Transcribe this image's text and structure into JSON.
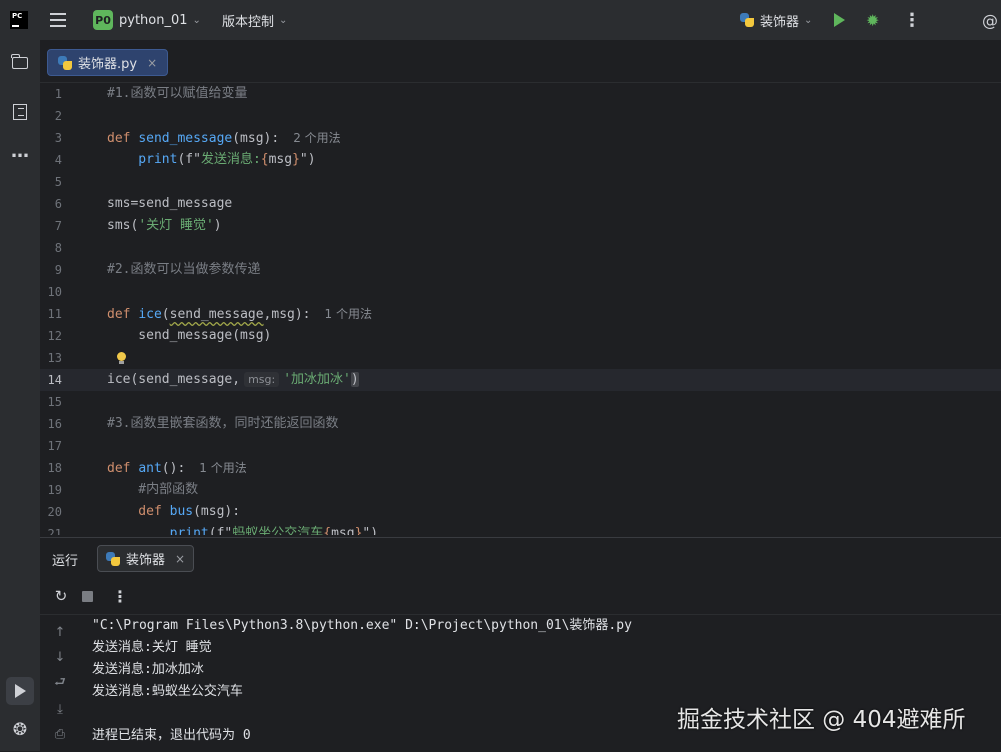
{
  "titlebar": {
    "logo_text": "PC",
    "project_badge": "P0",
    "project_name": "python_01",
    "vcs_label": "版本控制",
    "run_config": "装饰器"
  },
  "editor_tab": {
    "file_name": "装饰器.py"
  },
  "code_lines": [
    {
      "n": "1",
      "tokens": [
        {
          "t": "#1.函数可以赋值给变量",
          "c": "cmt"
        }
      ]
    },
    {
      "n": "2",
      "tokens": []
    },
    {
      "n": "3",
      "tokens": [
        {
          "t": "def ",
          "c": "kw"
        },
        {
          "t": "send_message",
          "c": "fn"
        },
        {
          "t": "(msg):",
          "c": ""
        }
      ],
      "hint": "2 个用法"
    },
    {
      "n": "4",
      "tokens": [
        {
          "t": "    print",
          "c": "fn"
        },
        {
          "t": "(f\"",
          "c": ""
        },
        {
          "t": "发送消息:",
          "c": "str"
        },
        {
          "t": "{",
          "c": "fstr"
        },
        {
          "t": "msg",
          "c": ""
        },
        {
          "t": "}",
          "c": "fstr"
        },
        {
          "t": "\")",
          "c": ""
        }
      ]
    },
    {
      "n": "5",
      "tokens": []
    },
    {
      "n": "6",
      "tokens": [
        {
          "t": "sms=send_message",
          "c": ""
        }
      ]
    },
    {
      "n": "7",
      "tokens": [
        {
          "t": "sms(",
          "c": ""
        },
        {
          "t": "'关灯 睡觉'",
          "c": "str"
        },
        {
          "t": ")",
          "c": ""
        }
      ]
    },
    {
      "n": "8",
      "tokens": []
    },
    {
      "n": "9",
      "tokens": [
        {
          "t": "#2.函数可以当做参数传递",
          "c": "cmt"
        }
      ]
    },
    {
      "n": "10",
      "tokens": []
    },
    {
      "n": "11",
      "tokens": [
        {
          "t": "def ",
          "c": "kw"
        },
        {
          "t": "ice",
          "c": "fn"
        },
        {
          "t": "(",
          "c": ""
        },
        {
          "t": "send_message",
          "c": "wavy"
        },
        {
          "t": ",msg):",
          "c": ""
        }
      ],
      "hint": "1 个用法"
    },
    {
      "n": "12",
      "tokens": [
        {
          "t": "    send_message(msg)",
          "c": ""
        }
      ]
    },
    {
      "n": "13",
      "tokens": []
    },
    {
      "n": "14",
      "tokens": [
        {
          "t": "ice(send_message,",
          "c": ""
        },
        {
          "t": "msg:",
          "c": "param"
        },
        {
          "t": "'加冰加冰'",
          "c": "str"
        },
        {
          "t": ")",
          "c": "bracket"
        }
      ],
      "current": true
    },
    {
      "n": "15",
      "tokens": []
    },
    {
      "n": "16",
      "tokens": [
        {
          "t": "#3.函数里嵌套函数，同时还能返回函数",
          "c": "cmt"
        }
      ]
    },
    {
      "n": "17",
      "tokens": []
    },
    {
      "n": "18",
      "tokens": [
        {
          "t": "def ",
          "c": "kw"
        },
        {
          "t": "ant",
          "c": "fn"
        },
        {
          "t": "():",
          "c": ""
        }
      ],
      "hint": "1 个用法"
    },
    {
      "n": "19",
      "tokens": [
        {
          "t": "    #内部函数",
          "c": "cmt"
        }
      ]
    },
    {
      "n": "20",
      "tokens": [
        {
          "t": "    def ",
          "c": "kw"
        },
        {
          "t": "bus",
          "c": "fn"
        },
        {
          "t": "(msg):",
          "c": ""
        }
      ]
    },
    {
      "n": "21",
      "tokens": [
        {
          "t": "        print",
          "c": "fn"
        },
        {
          "t": "(f\"",
          "c": ""
        },
        {
          "t": "蚂蚁坐公交汽车",
          "c": "str"
        },
        {
          "t": "{",
          "c": "fstr"
        },
        {
          "t": "msg",
          "c": ""
        },
        {
          "t": "}",
          "c": "fstr"
        },
        {
          "t": "\")",
          "c": ""
        }
      ]
    }
  ],
  "run_panel": {
    "title": "运行",
    "tab_name": "装饰器",
    "console_lines": [
      "\"C:\\Program Files\\Python3.8\\python.exe\" D:\\Project\\python_01\\装饰器.py",
      "发送消息:关灯 睡觉",
      "发送消息:加冰加冰",
      "发送消息:蚂蚁坐公交汽车",
      "",
      "进程已结束，退出代码为 0"
    ]
  },
  "watermark": "掘金技术社区 @ 404避难所",
  "icons": {
    "close": "×",
    "chevron": "⌄",
    "more": "⋮",
    "rerun": "↻",
    "up": "↑",
    "down": "↓",
    "wrap": "⮐",
    "scroll_end": "⤓",
    "print": "⎙",
    "ai": "@",
    "python_console": "❂",
    "debug": "✹",
    "ellipsis": "…"
  }
}
